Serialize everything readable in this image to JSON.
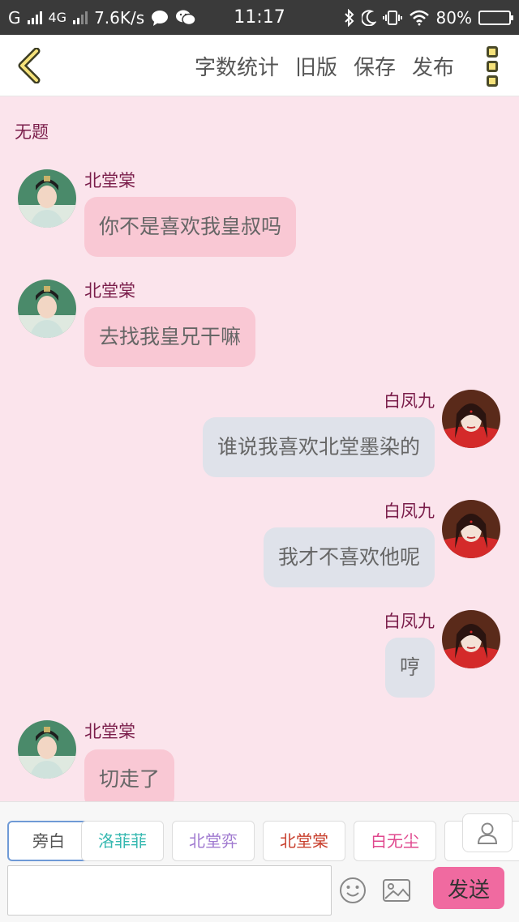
{
  "status_bar": {
    "carrier": "G",
    "network": "4G",
    "speed": "7.6K/s",
    "time": "11:17",
    "battery": "80%",
    "battery_level": 0.8
  },
  "header": {
    "back_icon": "chevron-left-icon",
    "actions": [
      "字数统计",
      "旧版",
      "保存",
      "发布"
    ],
    "more_icon": "more-vertical-icon"
  },
  "chat": {
    "title": "无题",
    "messages": [
      {
        "side": "left",
        "name": "北堂棠",
        "text": "你不是喜欢我皇叔吗"
      },
      {
        "side": "left",
        "name": "北堂棠",
        "text": "去找我皇兄干嘛"
      },
      {
        "side": "right",
        "name": "白凤九",
        "text": "谁说我喜欢北堂墨染的"
      },
      {
        "side": "right",
        "name": "白凤九",
        "text": "我才不喜欢他呢"
      },
      {
        "side": "right",
        "name": "白凤九",
        "text": "哼"
      },
      {
        "side": "left",
        "name": "北堂棠",
        "text": "切走了"
      }
    ]
  },
  "characters": [
    {
      "label": "旁白",
      "color": "#555555",
      "active": true
    },
    {
      "label": "洛菲菲",
      "color": "#35b8b0"
    },
    {
      "label": "北堂弈",
      "color": "#a07ad0"
    },
    {
      "label": "北堂棠",
      "color": "#c8402e"
    },
    {
      "label": "白无尘",
      "color": "#e0488e"
    }
  ],
  "input": {
    "placeholder": "",
    "value": ""
  },
  "toolbar": {
    "emoji_icon": "smile-icon",
    "image_icon": "image-icon",
    "user_icon": "user-icon",
    "send_label": "发送"
  },
  "colors": {
    "background": "#fbe4ec",
    "left_bubble": "#f9c8d4",
    "right_bubble": "#dfe2ea",
    "name": "#7a1d4a",
    "send": "#f06aa0"
  }
}
